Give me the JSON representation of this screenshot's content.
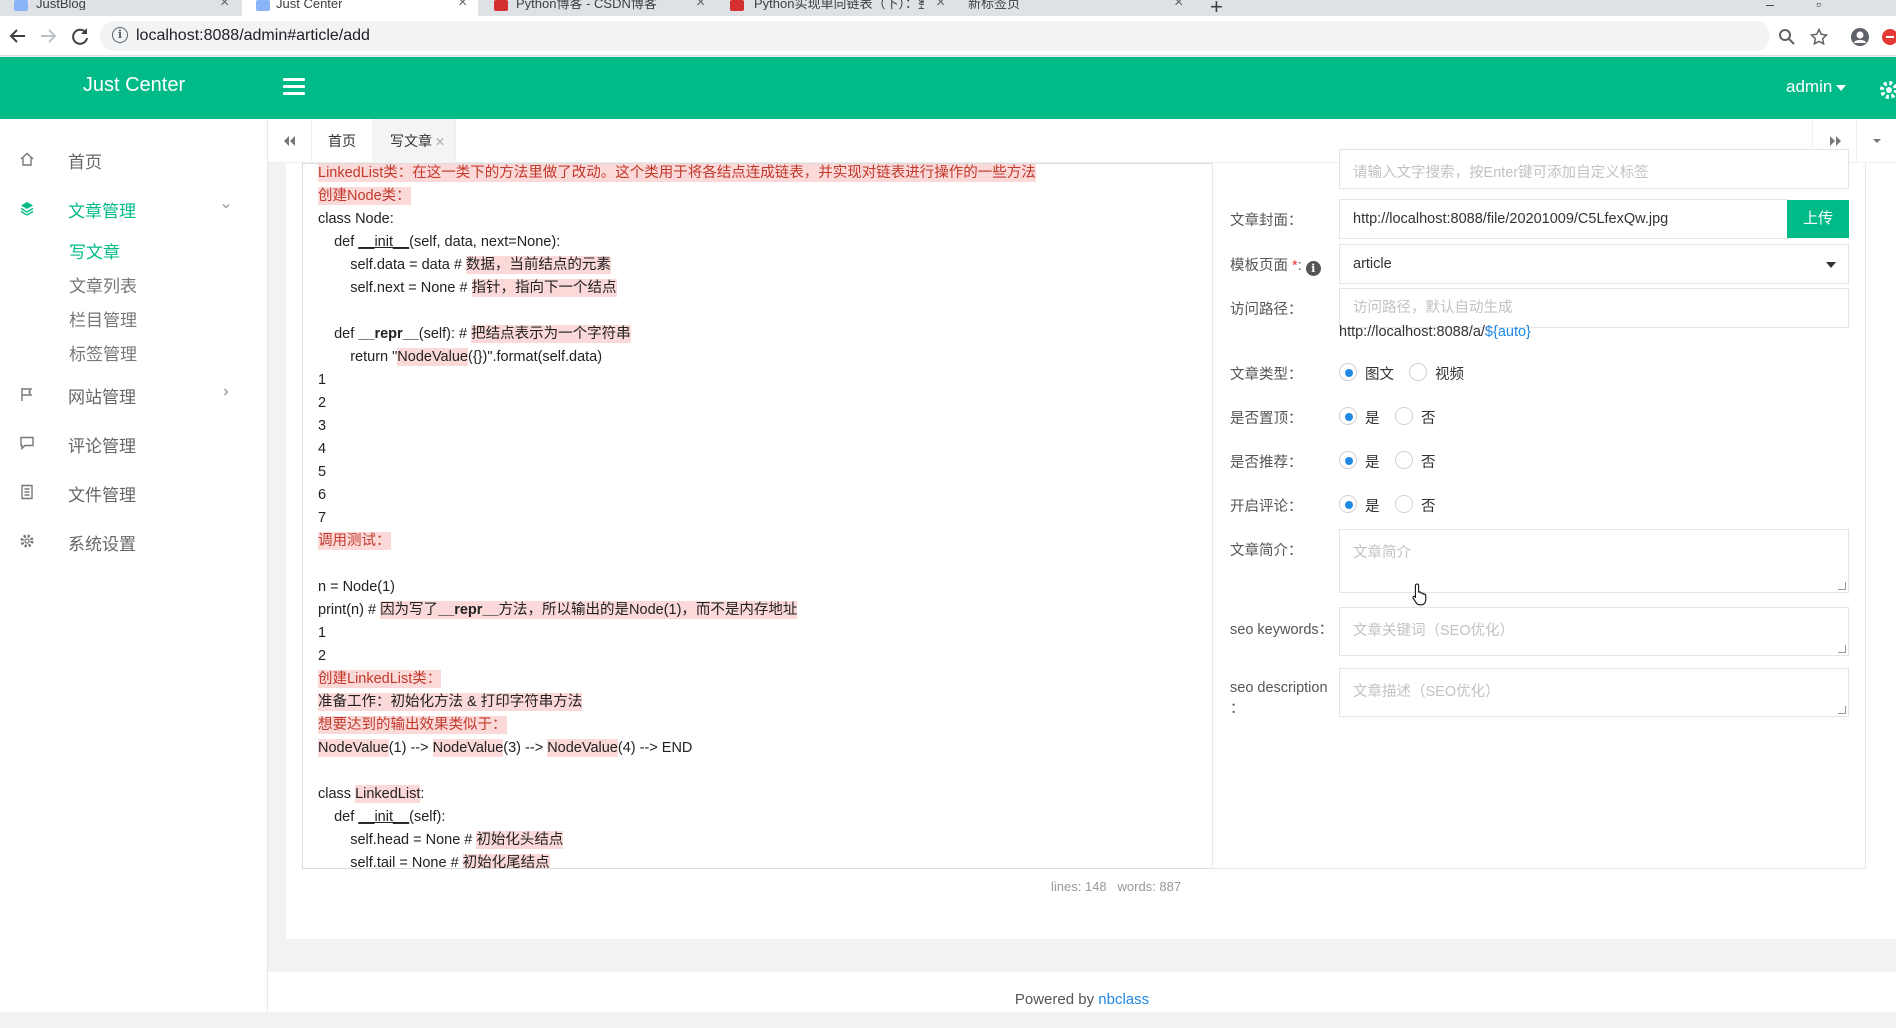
{
  "browser": {
    "tabs": [
      {
        "title": "JustBlog",
        "color": "#8ab4f8"
      },
      {
        "title": "Just Center",
        "color": "#8ab4f8"
      },
      {
        "title": "Python博客 - CSDN博客",
        "color": "#d32f2f"
      },
      {
        "title": "Python实现单向链表（下）：整",
        "color": "#d32f2f"
      },
      {
        "title": "新标签页",
        "color": ""
      }
    ],
    "url": "localhost:8088/admin#article/add"
  },
  "header": {
    "logo": "Just Center",
    "user": "admin"
  },
  "sidebar": {
    "items": [
      {
        "label": "首页",
        "icon": "home-icon"
      },
      {
        "label": "文章管理",
        "icon": "layers-icon",
        "open": true,
        "children": [
          "写文章",
          "文章列表",
          "栏目管理",
          "标签管理"
        ]
      },
      {
        "label": "网站管理",
        "icon": "flag-icon"
      },
      {
        "label": "评论管理",
        "icon": "comment-icon"
      },
      {
        "label": "文件管理",
        "icon": "file-icon"
      },
      {
        "label": "系统设置",
        "icon": "gear-icon"
      }
    ]
  },
  "page_tabs": [
    {
      "label": "首页",
      "closable": false
    },
    {
      "label": "写文章",
      "closable": true,
      "active": true
    }
  ],
  "editor": {
    "lines": [
      [
        {
          "t": "LinkedList类：在这一类下的方法里做了改动。这个类用于将各结点连成链表，并实现对链表进行操作的一些方法",
          "hl": true
        }
      ],
      [
        {
          "t": "创建Node类：",
          "hl": true
        }
      ],
      [
        {
          "t": "class Node:"
        }
      ],
      [
        {
          "t": "    def "
        },
        {
          "t": "__init__",
          "u": true
        },
        {
          "t": "(self, data, next=None):"
        }
      ],
      [
        {
          "t": "        self.data = data # "
        },
        {
          "t": "数据，当前结点的元素",
          "hl": true,
          "bk": true
        }
      ],
      [
        {
          "t": "        self.next = None # "
        },
        {
          "t": "指针，指向下一个结点",
          "hl": true,
          "bk": true
        }
      ],
      [
        {
          "t": ""
        }
      ],
      [
        {
          "t": "    def "
        },
        {
          "t": "__repr__",
          "b": true
        },
        {
          "t": "(self): # "
        },
        {
          "t": "把结点表示为一个字符串",
          "hl": true,
          "bk": true
        }
      ],
      [
        {
          "t": "        return \""
        },
        {
          "t": "NodeValue",
          "hl": true,
          "bk": true
        },
        {
          "t": "({})\".format(self.data)"
        }
      ],
      [
        {
          "t": "1"
        }
      ],
      [
        {
          "t": "2"
        }
      ],
      [
        {
          "t": "3"
        }
      ],
      [
        {
          "t": "4"
        }
      ],
      [
        {
          "t": "5"
        }
      ],
      [
        {
          "t": "6"
        }
      ],
      [
        {
          "t": "7"
        }
      ],
      [
        {
          "t": "调用测试：",
          "hl": true
        }
      ],
      [
        {
          "t": ""
        }
      ],
      [
        {
          "t": "n = Node(1)"
        }
      ],
      [
        {
          "t": "print(n) # "
        },
        {
          "t": "因为写了",
          "hl": true,
          "bk": true
        },
        {
          "t": "__repr__",
          "hl": true,
          "bk": true,
          "b": true
        },
        {
          "t": "方法，所以输出的是Node(1)，而不是内存地址",
          "hl": true,
          "bk": true
        }
      ],
      [
        {
          "t": "1"
        }
      ],
      [
        {
          "t": "2"
        }
      ],
      [
        {
          "t": "创建LinkedList类：",
          "hl": true
        }
      ],
      [
        {
          "t": "准备工作：初始化方法 & 打印字符串方法",
          "hl": true,
          "bk": true
        }
      ],
      [
        {
          "t": "想要达到的输出效果类似于：",
          "hl": true
        }
      ],
      [
        {
          "t": "NodeValue",
          "hl": true,
          "bk": true
        },
        {
          "t": "(1) --> "
        },
        {
          "t": "NodeValue",
          "hl": true,
          "bk": true
        },
        {
          "t": "(3) --> "
        },
        {
          "t": "NodeValue",
          "hl": true,
          "bk": true
        },
        {
          "t": "(4) --> END"
        }
      ],
      [
        {
          "t": ""
        }
      ],
      [
        {
          "t": "class "
        },
        {
          "t": "LinkedList",
          "hl": true,
          "bk": true
        },
        {
          "t": ":"
        }
      ],
      [
        {
          "t": "    def "
        },
        {
          "t": "__init__",
          "u": true
        },
        {
          "t": "(self):"
        }
      ],
      [
        {
          "t": "        self.head = None # "
        },
        {
          "t": "初始化头结点",
          "hl": true,
          "bk": true
        }
      ],
      [
        {
          "t": "        self.tail = None # "
        },
        {
          "t": "初始化尾结点",
          "hl": true,
          "bk": true
        }
      ]
    ],
    "status_lines": "lines: 148",
    "status_words": "words: 887"
  },
  "form": {
    "tags_placeholder": "请输入文字搜索，按Enter键可添加自定义标签",
    "cover_label": "文章封面：",
    "cover_value": "http://localhost:8088/file/20201009/C5LfexQw.jpg",
    "upload_label": "上传",
    "template_label": "模板页面",
    "template_req": "*",
    "template_colon": ":",
    "template_value": "article",
    "path_label": "访问路径：",
    "path_placeholder": "访问路径，默认自动生成",
    "path_prefix": "http://localhost:8088/a/",
    "path_auto": "${auto}",
    "type_label": "文章类型：",
    "type_options": [
      "图文",
      "视频"
    ],
    "top_label": "是否置顶：",
    "recommend_label": "是否推荐：",
    "comment_label": "开启评论：",
    "yes": "是",
    "no": "否",
    "summary_label": "文章简介：",
    "summary_placeholder": "文章简介",
    "seo_keywords_label": "seo keywords：",
    "seo_keywords_placeholder": "文章关键词（SEO优化）",
    "seo_desc_label": "seo description",
    "seo_desc_colon": "：",
    "seo_desc_placeholder": "文章描述（SEO优化）"
  },
  "footer": {
    "text": "Powered by ",
    "link": "nbclass"
  },
  "colors": {
    "accent": "#00bb88",
    "radio_on": "#1e88e5",
    "highlight_bg": "#fcd9d9"
  }
}
